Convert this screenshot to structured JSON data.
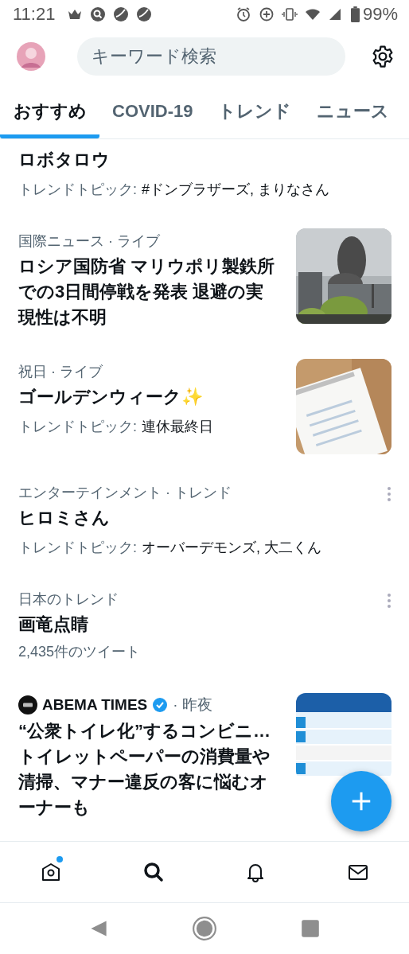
{
  "status_bar": {
    "time": "11:21",
    "battery": "99%"
  },
  "header": {
    "search": {
      "placeholder": "キーワード検索"
    }
  },
  "tabs": [
    {
      "label": "おすすめ",
      "selected": true
    },
    {
      "label": "COVID-19",
      "selected": false
    },
    {
      "label": "トレンド",
      "selected": false
    },
    {
      "label": "ニュース",
      "selected": false
    }
  ],
  "feed": [
    {
      "kind": "trend",
      "title": "ロボタロウ",
      "topic_label": "トレンドトピック:",
      "topics": "#ドンブラザーズ, まりなさん"
    },
    {
      "kind": "story",
      "meta": "国際ニュース · ライブ",
      "title": "ロシア国防省 マリウポリ製鉄所での3日間停戦を発表 退避の実現性は不明"
    },
    {
      "kind": "story",
      "meta": "祝日 · ライブ",
      "title": "ゴールデンウィーク✨",
      "topic_label": "トレンドトピック:",
      "topics": "連休最終日"
    },
    {
      "kind": "trend",
      "meta": "エンターテインメント · トレンド",
      "title": "ヒロミさん",
      "topic_label": "トレンドトピック:",
      "topics": "オーバーデモンズ, 大二くん",
      "menu": true
    },
    {
      "kind": "trend",
      "meta": "日本のトレンド",
      "title": "画竜点睛",
      "count": "2,435件のツイート",
      "menu": true
    },
    {
      "kind": "article",
      "source": "ABEMA TIMES",
      "verified": true,
      "time": "· 昨夜",
      "title": "“公衆トイレ化”するコンビニ… トイレットペーパーの消費量や清掃、マナー違反の客に悩むオーナーも"
    }
  ],
  "bottom_nav": [
    {
      "kind": "home",
      "selected": false,
      "badge": true
    },
    {
      "kind": "search",
      "selected": true
    },
    {
      "kind": "notifications",
      "selected": false
    },
    {
      "kind": "messages",
      "selected": false
    }
  ]
}
